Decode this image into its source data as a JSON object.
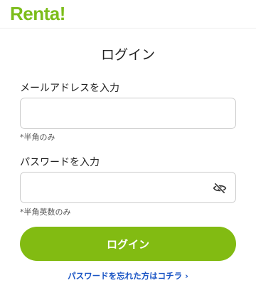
{
  "header": {
    "logo_text": "Renta!"
  },
  "page": {
    "title": "ログイン"
  },
  "form": {
    "email": {
      "label": "メールアドレスを入力",
      "value": "",
      "hint": "*半角のみ"
    },
    "password": {
      "label": "パスワードを入力",
      "value": "",
      "hint": "*半角英数のみ",
      "toggle_icon": "eye-off-icon"
    },
    "submit_label": "ログイン"
  },
  "links": {
    "forgot_password": "パスワードを忘れた方はコチラ"
  },
  "colors": {
    "brand": "#7cbd1a",
    "button": "#82bb12",
    "link": "#1a55c5"
  }
}
